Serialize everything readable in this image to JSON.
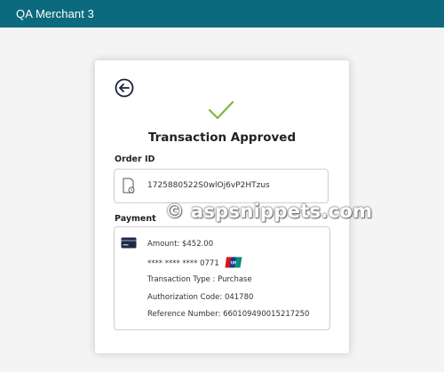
{
  "header": {
    "merchant_name": "QA Merchant 3",
    "bg_color": "#0b6a7e"
  },
  "card": {
    "status_title": "Transaction Approved",
    "order_section_label": "Order ID",
    "order_id": "1725880522S0wlOj6vP2HTzus",
    "payment_section_label": "Payment",
    "amount": "Amount: $452.00",
    "masked_card": "**** **** **** 0771",
    "card_brand": "UnionPay",
    "transaction_type": "Transaction Type : Purchase",
    "authorization_code": "Authorization Code: 041780",
    "reference_number": "Reference Number: 660109490015217250"
  },
  "icons": {
    "back": "back-arrow-circle-icon",
    "status": "checkmark-icon",
    "order": "document-icon",
    "payment": "credit-card-icon"
  },
  "colors": {
    "accent_green": "#7cb83a",
    "card_icon": "#1e2a44"
  },
  "watermark": {
    "text": "© aspsnippets.com"
  }
}
